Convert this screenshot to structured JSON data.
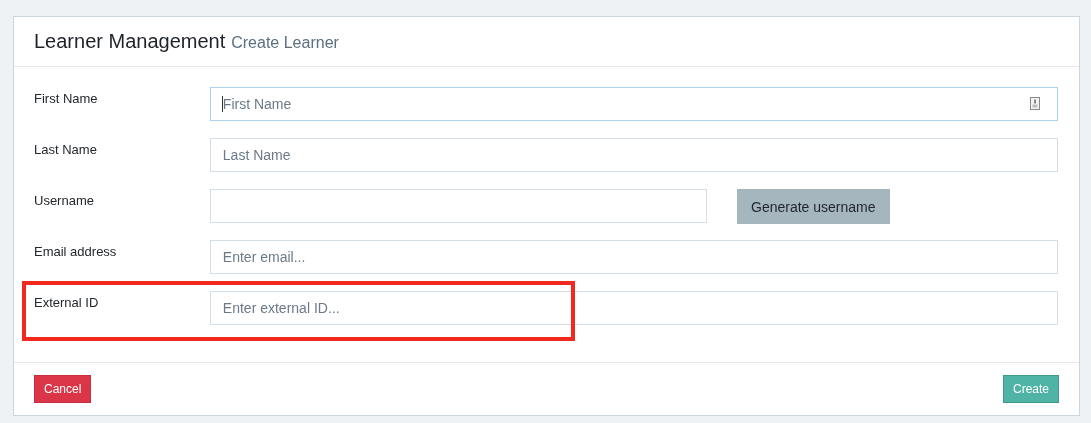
{
  "header": {
    "title": "Learner Management",
    "subtitle": "Create Learner"
  },
  "fields": [
    {
      "label": "First Name",
      "placeholder": "First Name",
      "focused": true,
      "highlighted": false,
      "kind": "contact"
    },
    {
      "label": "Last Name",
      "placeholder": "Last Name",
      "focused": false,
      "highlighted": false,
      "kind": "text"
    },
    {
      "label": "Username",
      "focused": false,
      "highlighted": false,
      "kind": "generate",
      "button": "Generate username"
    },
    {
      "label": "Email address",
      "placeholder": "Enter email...",
      "focused": false,
      "highlighted": false,
      "kind": "text"
    },
    {
      "label": "External ID",
      "placeholder": "Enter external ID...",
      "focused": false,
      "highlighted": true,
      "kind": "text"
    }
  ],
  "footer": {
    "cancel": "Cancel",
    "create": "Create"
  }
}
